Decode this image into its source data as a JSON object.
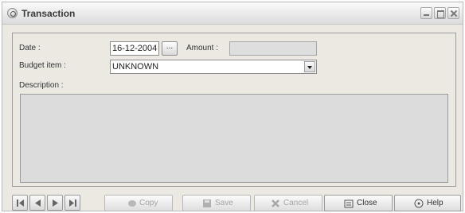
{
  "window": {
    "title": "Transaction"
  },
  "form": {
    "date_label": "Date :",
    "date_value": "16-12-2004",
    "date_button": "...",
    "amount_label": "Amount :",
    "amount_value": "",
    "budget_label": "Budget item :",
    "budget_value": "UNKNOWN",
    "description_label": "Description :",
    "description_value": ""
  },
  "toolbar": {
    "copy": "Copy",
    "save": "Save",
    "cancel": "Cancel",
    "close": "Close",
    "help": "Help"
  },
  "icons": [
    "first-record-icon",
    "previous-record-icon",
    "next-record-icon",
    "last-record-icon",
    "copy-icon",
    "save-icon",
    "cancel-icon",
    "close-icon",
    "help-icon"
  ]
}
